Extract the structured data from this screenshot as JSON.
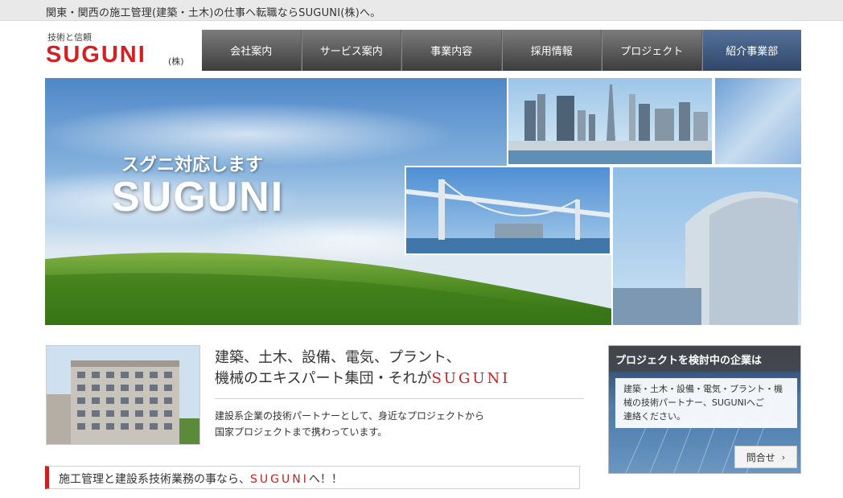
{
  "header": {
    "tagline": "関東・関西の施工管理(建築・土木)の仕事へ転職ならSUGUNI(株)へ。"
  },
  "logo": {
    "sub": "技術と信頼",
    "main": "SUGUNI",
    "corp": "(株)"
  },
  "nav": {
    "items": [
      {
        "label": "会社案内"
      },
      {
        "label": "サービス案内"
      },
      {
        "label": "事業内容"
      },
      {
        "label": "採用情報"
      },
      {
        "label": "プロジェクト"
      },
      {
        "label": "紹介事業部"
      }
    ]
  },
  "hero": {
    "catch_sub": "スグニ対応します",
    "catch_main": "SUGUNI"
  },
  "intro": {
    "headline_1": "建築、土木、設備、電気、プラント、",
    "headline_2": "機械のエキスパート集団・それが",
    "headline_brand": "SUGUNI",
    "body_1": "建設系企業の技術パートナーとして、身近なプロジェクトから",
    "body_2": "国家プロジェクトまで携わっています。"
  },
  "banner": {
    "text": "施工管理と建設系技術業務の事なら、",
    "brand": "SUGUNI",
    "suffix": "へ！！"
  },
  "side": {
    "title": "プロジェクトを検討中の企業は",
    "body_1": "建築・土木・設備・電気・プラント・機",
    "body_2": "械の技術パートナー、SUGUNIへご",
    "body_3": "連絡ください。",
    "button_label": "問合せ"
  },
  "colors": {
    "brand_red": "#d42020",
    "nav_active": "#2f4668",
    "nav_default": "#3d3d3d"
  }
}
